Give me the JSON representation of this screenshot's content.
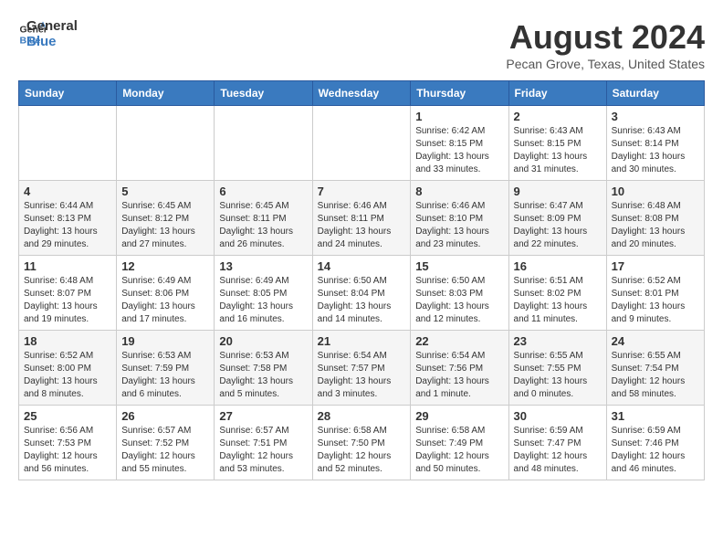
{
  "header": {
    "logo_line1": "General",
    "logo_line2": "Blue",
    "month_year": "August 2024",
    "location": "Pecan Grove, Texas, United States"
  },
  "weekdays": [
    "Sunday",
    "Monday",
    "Tuesday",
    "Wednesday",
    "Thursday",
    "Friday",
    "Saturday"
  ],
  "weeks": [
    [
      {
        "day": "",
        "info": ""
      },
      {
        "day": "",
        "info": ""
      },
      {
        "day": "",
        "info": ""
      },
      {
        "day": "",
        "info": ""
      },
      {
        "day": "1",
        "info": "Sunrise: 6:42 AM\nSunset: 8:15 PM\nDaylight: 13 hours\nand 33 minutes."
      },
      {
        "day": "2",
        "info": "Sunrise: 6:43 AM\nSunset: 8:15 PM\nDaylight: 13 hours\nand 31 minutes."
      },
      {
        "day": "3",
        "info": "Sunrise: 6:43 AM\nSunset: 8:14 PM\nDaylight: 13 hours\nand 30 minutes."
      }
    ],
    [
      {
        "day": "4",
        "info": "Sunrise: 6:44 AM\nSunset: 8:13 PM\nDaylight: 13 hours\nand 29 minutes."
      },
      {
        "day": "5",
        "info": "Sunrise: 6:45 AM\nSunset: 8:12 PM\nDaylight: 13 hours\nand 27 minutes."
      },
      {
        "day": "6",
        "info": "Sunrise: 6:45 AM\nSunset: 8:11 PM\nDaylight: 13 hours\nand 26 minutes."
      },
      {
        "day": "7",
        "info": "Sunrise: 6:46 AM\nSunset: 8:11 PM\nDaylight: 13 hours\nand 24 minutes."
      },
      {
        "day": "8",
        "info": "Sunrise: 6:46 AM\nSunset: 8:10 PM\nDaylight: 13 hours\nand 23 minutes."
      },
      {
        "day": "9",
        "info": "Sunrise: 6:47 AM\nSunset: 8:09 PM\nDaylight: 13 hours\nand 22 minutes."
      },
      {
        "day": "10",
        "info": "Sunrise: 6:48 AM\nSunset: 8:08 PM\nDaylight: 13 hours\nand 20 minutes."
      }
    ],
    [
      {
        "day": "11",
        "info": "Sunrise: 6:48 AM\nSunset: 8:07 PM\nDaylight: 13 hours\nand 19 minutes."
      },
      {
        "day": "12",
        "info": "Sunrise: 6:49 AM\nSunset: 8:06 PM\nDaylight: 13 hours\nand 17 minutes."
      },
      {
        "day": "13",
        "info": "Sunrise: 6:49 AM\nSunset: 8:05 PM\nDaylight: 13 hours\nand 16 minutes."
      },
      {
        "day": "14",
        "info": "Sunrise: 6:50 AM\nSunset: 8:04 PM\nDaylight: 13 hours\nand 14 minutes."
      },
      {
        "day": "15",
        "info": "Sunrise: 6:50 AM\nSunset: 8:03 PM\nDaylight: 13 hours\nand 12 minutes."
      },
      {
        "day": "16",
        "info": "Sunrise: 6:51 AM\nSunset: 8:02 PM\nDaylight: 13 hours\nand 11 minutes."
      },
      {
        "day": "17",
        "info": "Sunrise: 6:52 AM\nSunset: 8:01 PM\nDaylight: 13 hours\nand 9 minutes."
      }
    ],
    [
      {
        "day": "18",
        "info": "Sunrise: 6:52 AM\nSunset: 8:00 PM\nDaylight: 13 hours\nand 8 minutes."
      },
      {
        "day": "19",
        "info": "Sunrise: 6:53 AM\nSunset: 7:59 PM\nDaylight: 13 hours\nand 6 minutes."
      },
      {
        "day": "20",
        "info": "Sunrise: 6:53 AM\nSunset: 7:58 PM\nDaylight: 13 hours\nand 5 minutes."
      },
      {
        "day": "21",
        "info": "Sunrise: 6:54 AM\nSunset: 7:57 PM\nDaylight: 13 hours\nand 3 minutes."
      },
      {
        "day": "22",
        "info": "Sunrise: 6:54 AM\nSunset: 7:56 PM\nDaylight: 13 hours\nand 1 minute."
      },
      {
        "day": "23",
        "info": "Sunrise: 6:55 AM\nSunset: 7:55 PM\nDaylight: 13 hours\nand 0 minutes."
      },
      {
        "day": "24",
        "info": "Sunrise: 6:55 AM\nSunset: 7:54 PM\nDaylight: 12 hours\nand 58 minutes."
      }
    ],
    [
      {
        "day": "25",
        "info": "Sunrise: 6:56 AM\nSunset: 7:53 PM\nDaylight: 12 hours\nand 56 minutes."
      },
      {
        "day": "26",
        "info": "Sunrise: 6:57 AM\nSunset: 7:52 PM\nDaylight: 12 hours\nand 55 minutes."
      },
      {
        "day": "27",
        "info": "Sunrise: 6:57 AM\nSunset: 7:51 PM\nDaylight: 12 hours\nand 53 minutes."
      },
      {
        "day": "28",
        "info": "Sunrise: 6:58 AM\nSunset: 7:50 PM\nDaylight: 12 hours\nand 52 minutes."
      },
      {
        "day": "29",
        "info": "Sunrise: 6:58 AM\nSunset: 7:49 PM\nDaylight: 12 hours\nand 50 minutes."
      },
      {
        "day": "30",
        "info": "Sunrise: 6:59 AM\nSunset: 7:47 PM\nDaylight: 12 hours\nand 48 minutes."
      },
      {
        "day": "31",
        "info": "Sunrise: 6:59 AM\nSunset: 7:46 PM\nDaylight: 12 hours\nand 46 minutes."
      }
    ]
  ]
}
